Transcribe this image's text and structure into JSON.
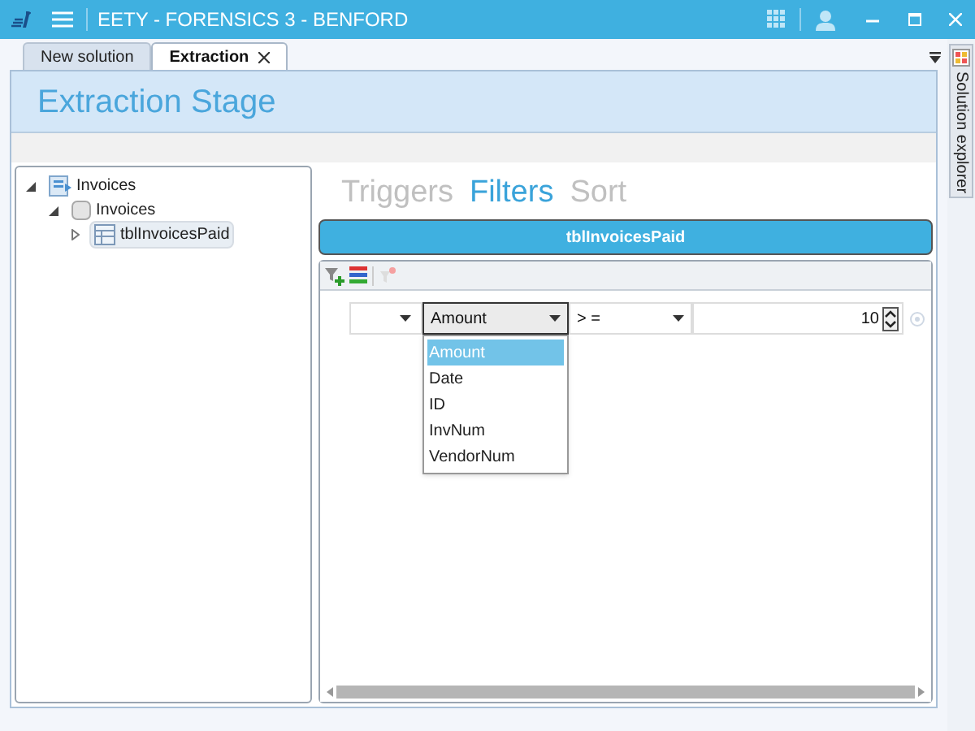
{
  "window": {
    "title": "EETY - FORENSICS 3 - BENFORD"
  },
  "tabs": [
    {
      "label": "New solution",
      "selected": false,
      "closable": false
    },
    {
      "label": "Extraction",
      "selected": true,
      "closable": true
    }
  ],
  "stage_title": "Extraction Stage",
  "tree": [
    {
      "label": "Invoices",
      "kind": "solution",
      "expanded": true,
      "selected": false,
      "children": [
        {
          "label": "Invoices",
          "kind": "database",
          "expanded": true,
          "selected": false,
          "children": [
            {
              "label": "tblInvoicesPaid",
              "kind": "table",
              "expanded": false,
              "selected": true
            }
          ]
        }
      ]
    }
  ],
  "section_tabs": [
    {
      "label": "Triggers",
      "selected": false
    },
    {
      "label": "Filters",
      "selected": true
    },
    {
      "label": "Sort",
      "selected": false
    }
  ],
  "table_name": "tblInvoicesPaid",
  "filter": {
    "field": "Amount",
    "operator": "> =",
    "value": "10"
  },
  "field_options": [
    {
      "label": "Amount",
      "selected": true
    },
    {
      "label": "Date",
      "selected": false
    },
    {
      "label": "ID",
      "selected": false
    },
    {
      "label": "InvNum",
      "selected": false
    },
    {
      "label": "VendorNum",
      "selected": false
    }
  ],
  "side_panel": {
    "label": "Solution explorer"
  }
}
